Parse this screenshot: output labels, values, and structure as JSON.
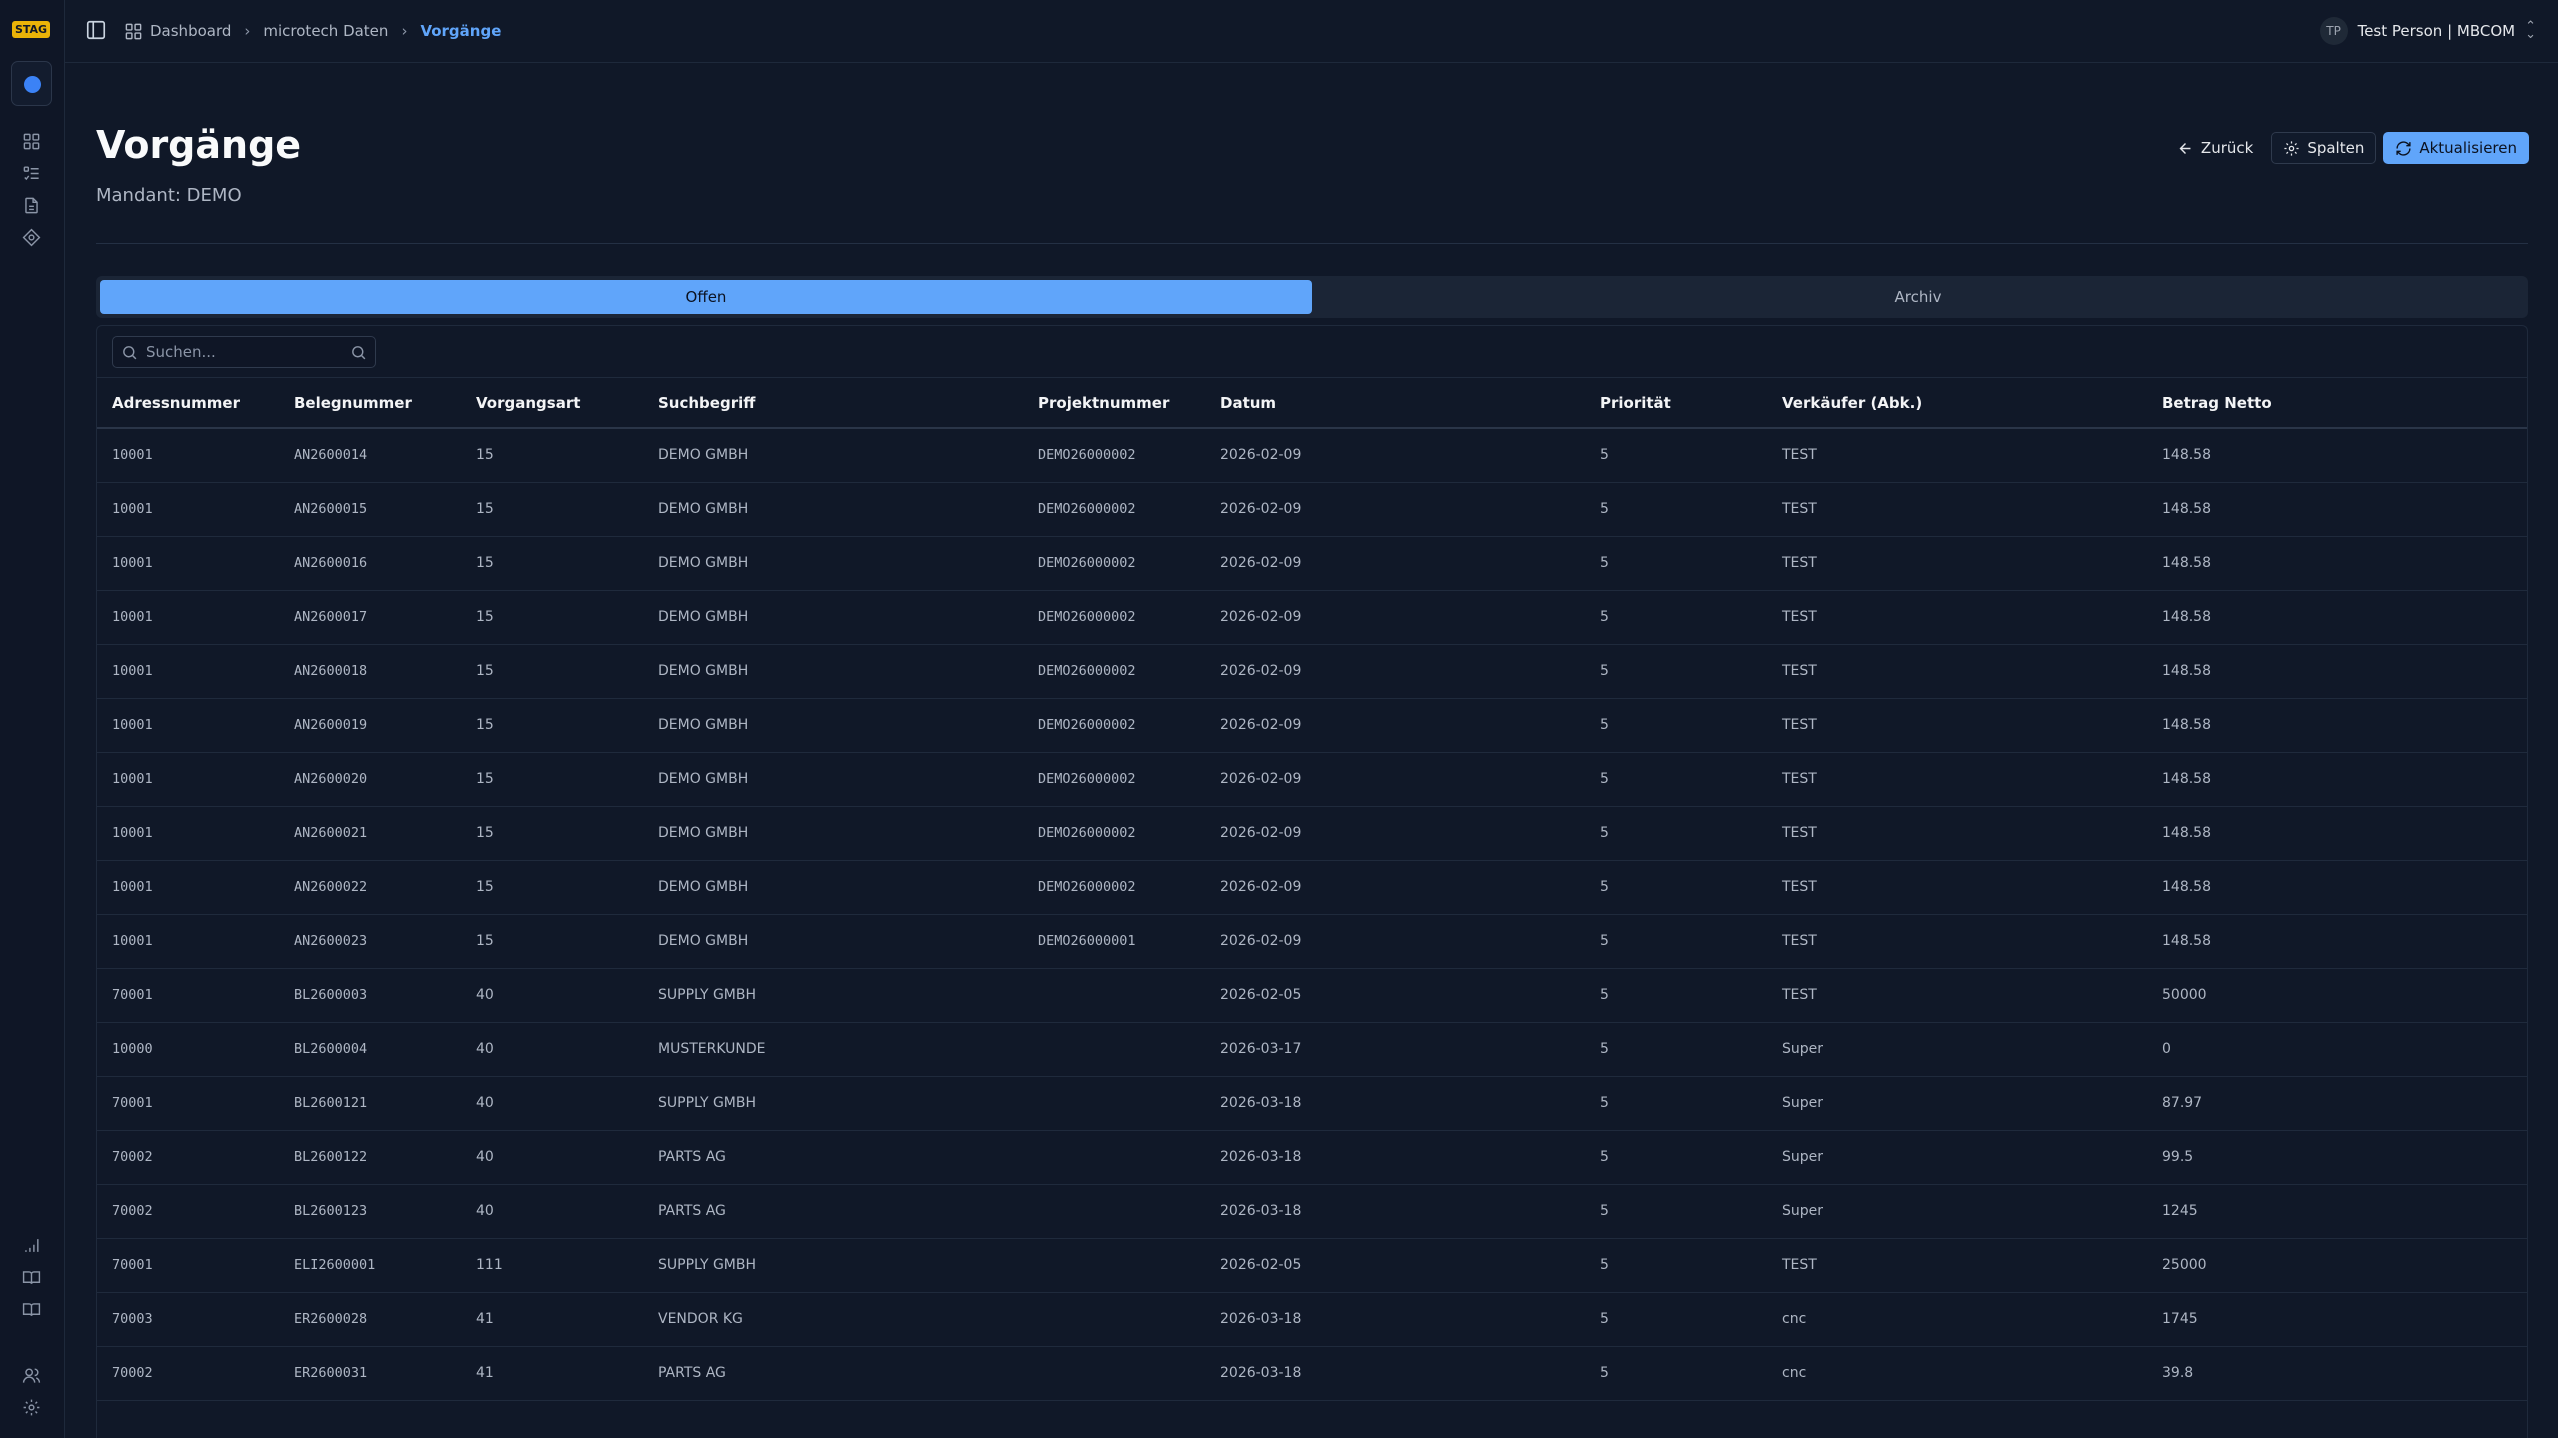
{
  "env_badge": "STAG",
  "breadcrumb": {
    "items": [
      {
        "label": "Dashboard"
      },
      {
        "label": "microtech Daten"
      },
      {
        "label": "Vorgänge"
      }
    ]
  },
  "user": {
    "initials": "TP",
    "label": "Test Person | MBCOM"
  },
  "page": {
    "title": "Vorgänge",
    "subtitle": "Mandant: DEMO"
  },
  "actions": {
    "back": "Zurück",
    "columns": "Spalten",
    "refresh": "Aktualisieren"
  },
  "tabs": {
    "open": "Offen",
    "archive": "Archiv"
  },
  "search": {
    "placeholder": "Suchen..."
  },
  "table": {
    "columns": [
      "Adressnummer",
      "Belegnummer",
      "Vorgangsart",
      "Suchbegriff",
      "Projektnummer",
      "Datum",
      "Priorität",
      "Verkäufer (Abk.)",
      "Betrag Netto"
    ],
    "rows": [
      [
        "10001",
        "AN2600014",
        "15",
        "DEMO GMBH",
        "DEMO26000002",
        "2026-02-09",
        "5",
        "TEST",
        "148.58"
      ],
      [
        "10001",
        "AN2600015",
        "15",
        "DEMO GMBH",
        "DEMO26000002",
        "2026-02-09",
        "5",
        "TEST",
        "148.58"
      ],
      [
        "10001",
        "AN2600016",
        "15",
        "DEMO GMBH",
        "DEMO26000002",
        "2026-02-09",
        "5",
        "TEST",
        "148.58"
      ],
      [
        "10001",
        "AN2600017",
        "15",
        "DEMO GMBH",
        "DEMO26000002",
        "2026-02-09",
        "5",
        "TEST",
        "148.58"
      ],
      [
        "10001",
        "AN2600018",
        "15",
        "DEMO GMBH",
        "DEMO26000002",
        "2026-02-09",
        "5",
        "TEST",
        "148.58"
      ],
      [
        "10001",
        "AN2600019",
        "15",
        "DEMO GMBH",
        "DEMO26000002",
        "2026-02-09",
        "5",
        "TEST",
        "148.58"
      ],
      [
        "10001",
        "AN2600020",
        "15",
        "DEMO GMBH",
        "DEMO26000002",
        "2026-02-09",
        "5",
        "TEST",
        "148.58"
      ],
      [
        "10001",
        "AN2600021",
        "15",
        "DEMO GMBH",
        "DEMO26000002",
        "2026-02-09",
        "5",
        "TEST",
        "148.58"
      ],
      [
        "10001",
        "AN2600022",
        "15",
        "DEMO GMBH",
        "DEMO26000002",
        "2026-02-09",
        "5",
        "TEST",
        "148.58"
      ],
      [
        "10001",
        "AN2600023",
        "15",
        "DEMO GMBH",
        "DEMO26000001",
        "2026-02-09",
        "5",
        "TEST",
        "148.58"
      ],
      [
        "70001",
        "BL2600003",
        "40",
        "SUPPLY GMBH",
        "",
        "2026-02-05",
        "5",
        "TEST",
        "50000"
      ],
      [
        "10000",
        "BL2600004",
        "40",
        "MUSTERKUNDE",
        "",
        "2026-03-17",
        "5",
        "Super",
        "0"
      ],
      [
        "70001",
        "BL2600121",
        "40",
        "SUPPLY GMBH",
        "",
        "2026-03-18",
        "5",
        "Super",
        "87.97"
      ],
      [
        "70002",
        "BL2600122",
        "40",
        "PARTS AG",
        "",
        "2026-03-18",
        "5",
        "Super",
        "99.5"
      ],
      [
        "70002",
        "BL2600123",
        "40",
        "PARTS AG",
        "",
        "2026-03-18",
        "5",
        "Super",
        "1245"
      ],
      [
        "70001",
        "ELI2600001",
        "111",
        "SUPPLY GMBH",
        "",
        "2026-02-05",
        "5",
        "TEST",
        "25000"
      ],
      [
        "70003",
        "ER2600028",
        "41",
        "VENDOR KG",
        "",
        "2026-03-18",
        "5",
        "cnc",
        "1745"
      ],
      [
        "70002",
        "ER2600031",
        "41",
        "PARTS AG",
        "",
        "2026-03-18",
        "5",
        "cnc",
        "39.8"
      ]
    ]
  },
  "colors": {
    "accent": "#60a5fa",
    "background": "#101828",
    "badge": "#eab308"
  }
}
